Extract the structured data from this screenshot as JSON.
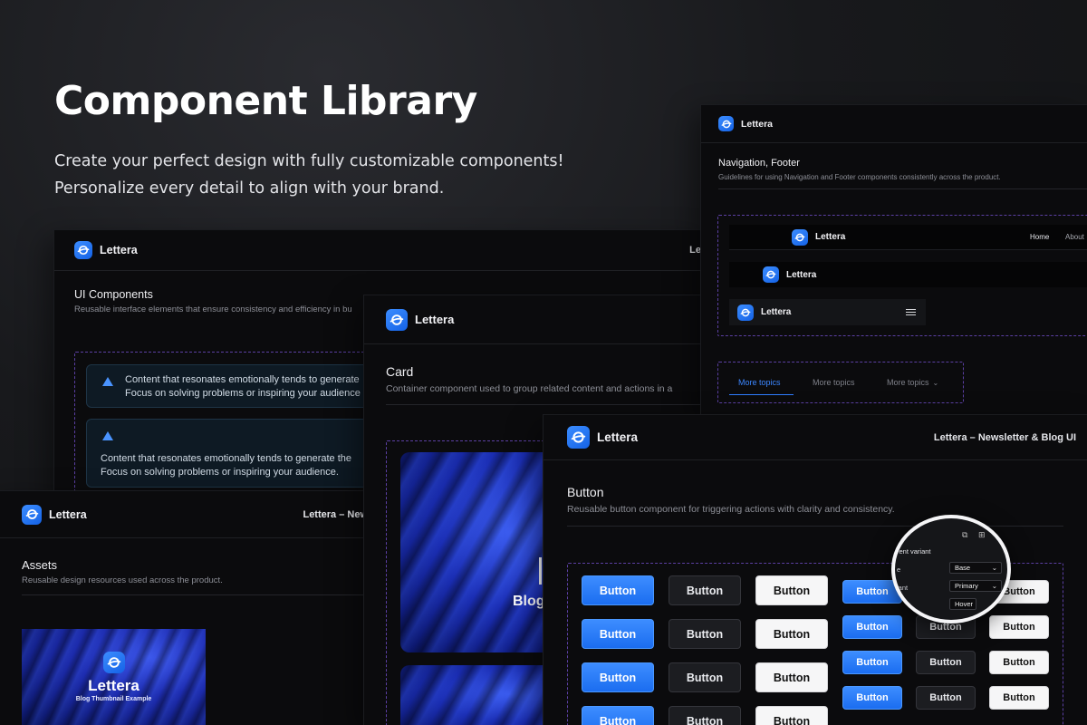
{
  "hero": {
    "title": "Component Library",
    "line1": "Create your perfect design with fully customizable components!",
    "line2": "Personalize every detail to align with your brand."
  },
  "brand": {
    "name": "Lettera",
    "accent": "#1F7AFF",
    "dash_color": "#5B3FA3"
  },
  "header_right": {
    "full": "Lettera – Newsletter & Blog UI",
    "truncated": "Lettera – New",
    "short": "Le"
  },
  "ui_components": {
    "title": "UI Components",
    "description": "Reusable interface elements that ensure consistency and efficiency in bu",
    "alerts": [
      {
        "line1": "Content that resonates emotionally tends to generate",
        "line2": "Focus on solving problems or inspiring your audience"
      },
      {
        "line1": "Content that resonates emotionally tends to generate the",
        "line2": "Focus on solving problems or inspiring your audience."
      }
    ]
  },
  "assets": {
    "title": "Assets",
    "description": "Reusable design resources used across the product.",
    "thumb_title": "Lettera",
    "thumb_subtitle": "Blog Thumbnail Example"
  },
  "card": {
    "title": "Card",
    "description": "Container component used to group related content and actions in a",
    "blog_text": "Blog"
  },
  "navigation": {
    "title": "Navigation, Footer",
    "description": "Guidelines for using Navigation and Footer components consistently across the product.",
    "nav_links": [
      "Home",
      "About"
    ],
    "tabs": [
      "More topics",
      "More topics",
      "More topics"
    ]
  },
  "button_section": {
    "title": "Button",
    "description": "Reusable button component for triggering actions with clarity and consistency.",
    "label": "Button"
  },
  "inspector": {
    "heading": "rent variant",
    "rows": [
      {
        "label": "e",
        "value": "Base"
      },
      {
        "label": "iant",
        "value": "Primary"
      },
      {
        "label": "",
        "value": "Hover"
      }
    ]
  }
}
